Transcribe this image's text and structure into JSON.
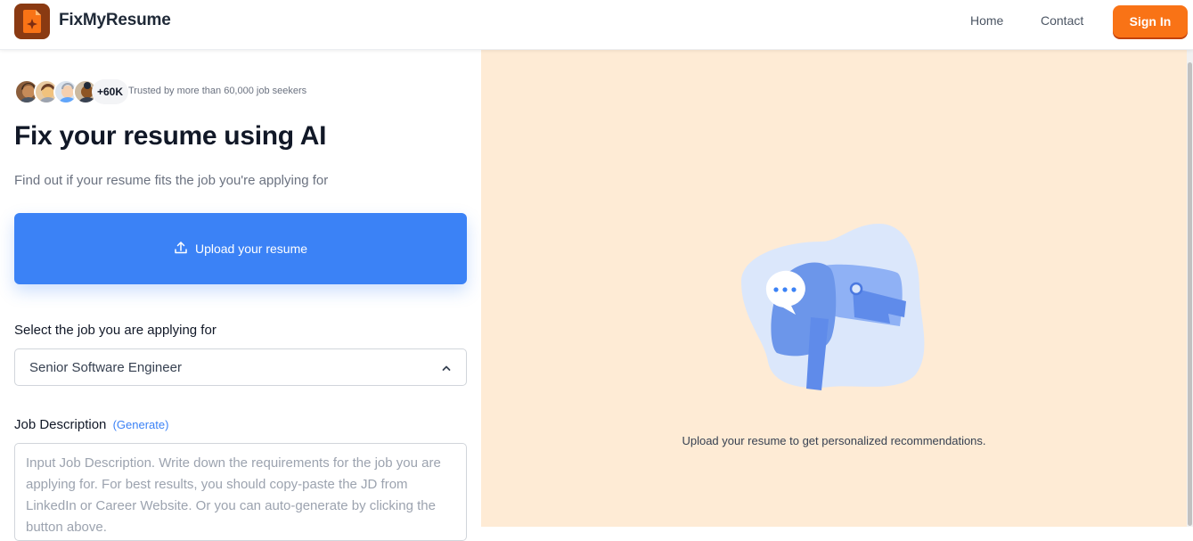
{
  "header": {
    "brand": "FixMyResume",
    "nav": {
      "home": "Home",
      "contact": "Contact"
    },
    "signin_label": "Sign In",
    "logo_icon": "document-sparkle-icon",
    "accent_color": "#f97316"
  },
  "hero": {
    "user_count": "+60K",
    "trust_text": "Trusted by more than 60,000 job seekers",
    "title": "Fix your resume using AI",
    "subtitle": "Find out if your resume fits the job you're applying for"
  },
  "upload": {
    "label": "Upload your resume",
    "icon": "upload-icon",
    "color": "#3b82f6"
  },
  "job_select": {
    "label": "Select the job you are applying for",
    "value": "Senior Software Engineer",
    "icon": "chevron-up-icon"
  },
  "job_description": {
    "label": "Job Description",
    "generate_label": "(Generate)",
    "placeholder": "Input Job Description. Write down the requirements for the job you are applying for. For best results, you should copy-paste the JD from LinkedIn or Career Website. Or you can auto-generate by clicking the button above."
  },
  "recommendations": {
    "empty_text": "Upload your resume to get personalized recommendations.",
    "illustration": "mailbox-illustration",
    "background": "#feebd5"
  }
}
